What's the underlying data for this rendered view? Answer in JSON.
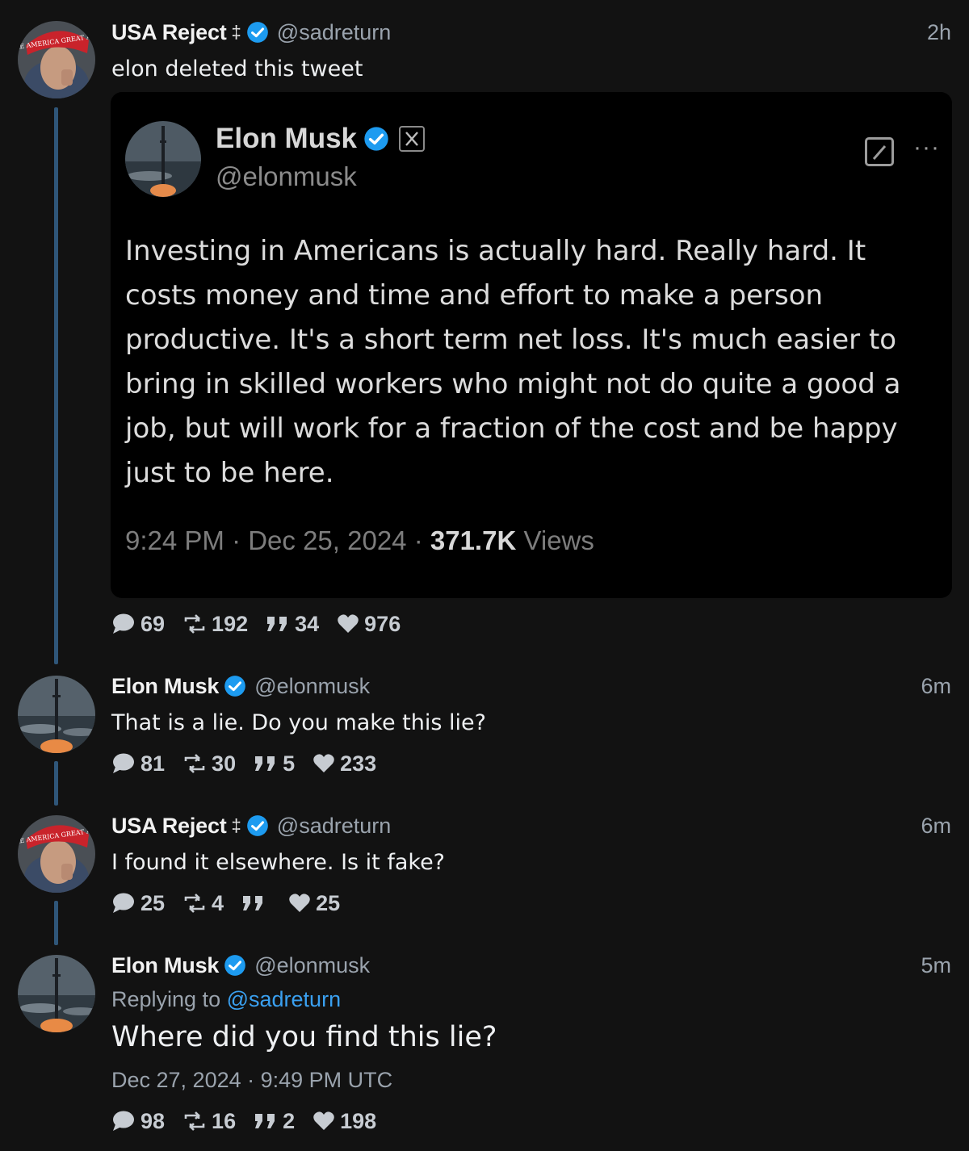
{
  "posts": [
    {
      "name": "USA Reject",
      "badge": "‡",
      "handle": "@sadreturn",
      "time": "2h",
      "text": "elon deleted this tweet",
      "hat_text": "MAKE AMERICA GREAT AGAIN",
      "stats": {
        "replies": "69",
        "reposts": "192",
        "quotes": "34",
        "likes": "976"
      }
    },
    {
      "name": "Elon Musk",
      "handle": "@elonmusk",
      "time": "6m",
      "text": "That is a lie. Do you make this lie?",
      "stats": {
        "replies": "81",
        "reposts": "30",
        "quotes": "5",
        "likes": "233"
      }
    },
    {
      "name": "USA Reject",
      "badge": "‡",
      "handle": "@sadreturn",
      "time": "6m",
      "text": "I found it elsewhere. Is it fake?",
      "hat_text": "MAKE AMERICA GREAT AGAIN",
      "stats": {
        "replies": "25",
        "reposts": "4",
        "quotes": "",
        "likes": "25"
      }
    },
    {
      "name": "Elon Musk",
      "handle": "@elonmusk",
      "time": "5m",
      "replying_label": "Replying to",
      "replying_to": "@sadreturn",
      "text": "Where did you find this lie?",
      "timestamp": "Dec 27, 2024 · 9:49 PM UTC",
      "stats": {
        "replies": "98",
        "reposts": "16",
        "quotes": "2",
        "likes": "198"
      }
    }
  ],
  "quoted": {
    "name": "Elon Musk",
    "handle": "@elonmusk",
    "text": "Investing in Americans is actually hard. Really hard. It costs money and time and effort to make a person productive. It's a short term net loss. It's much easier to bring in skilled workers who might not do quite a good a job, but will work for a fraction of the cost and be happy just to be here.",
    "meta_prefix": "9:24 PM · Dec 25, 2024 · ",
    "views_count": "371.7K",
    "views_label": " Views",
    "more": "···"
  },
  "colors": {
    "background": "#121212",
    "verified": "#1d9bf0",
    "thread_line": "#2f5679",
    "link": "#3aa0f0"
  },
  "icons": [
    "verified-icon",
    "reply-icon",
    "repost-icon",
    "quote-icon",
    "heart-icon",
    "x-logo-icon",
    "edit-icon",
    "more-icon"
  ]
}
